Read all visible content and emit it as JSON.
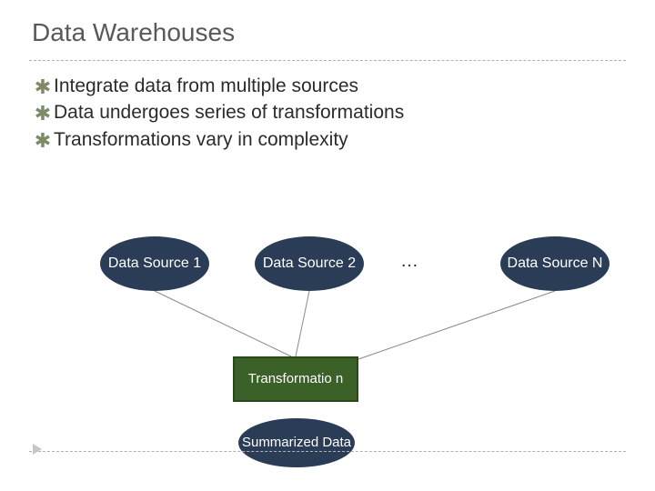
{
  "title": "Data Warehouses",
  "bullets": {
    "b1": "Integrate data from multiple sources",
    "b2": "Data undergoes series of transformations",
    "b3": "Transformations vary in complexity"
  },
  "diagram": {
    "source1": "Data Source 1",
    "source2": "Data Source 2",
    "sourceN": "Data Source N",
    "ellipsis": "…",
    "transform": "Transformatio\nn",
    "summary": "Summarized Data"
  }
}
